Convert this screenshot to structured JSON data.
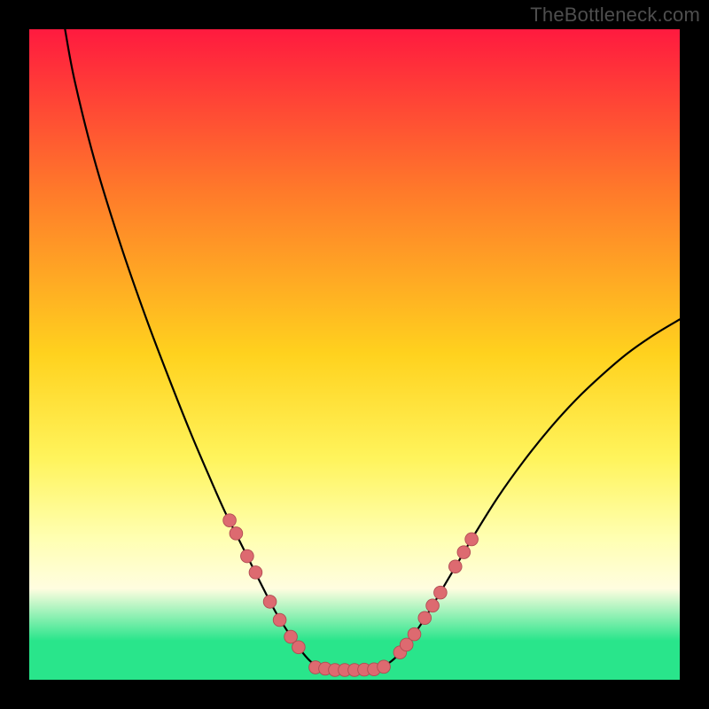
{
  "watermark": {
    "text": "TheBottleneck.com"
  },
  "colors": {
    "bg_black": "#000000",
    "grad_top": "#ff1a3f",
    "grad_mid1": "#ff7a2a",
    "grad_mid2": "#ffd21e",
    "grad_mid3": "#fff45c",
    "grad_low_yellow": "#ffffb0",
    "grad_cream": "#fffde0",
    "grad_green": "#29e58b",
    "curve": "#000000",
    "marker_fill": "#dd6a70",
    "marker_stroke": "#b04b52",
    "watermark": "#707070"
  },
  "chart_data": {
    "type": "line",
    "title": "",
    "xlabel": "",
    "ylabel": "",
    "xlim": [
      0,
      100
    ],
    "ylim": [
      0,
      100
    ],
    "grad_stops": [
      {
        "offset": 0.0,
        "color": "#ff1a3f"
      },
      {
        "offset": 0.25,
        "color": "#ff7a2a"
      },
      {
        "offset": 0.5,
        "color": "#ffd21e"
      },
      {
        "offset": 0.66,
        "color": "#fff45c"
      },
      {
        "offset": 0.78,
        "color": "#ffffb0"
      },
      {
        "offset": 0.86,
        "color": "#fffde0"
      },
      {
        "offset": 0.94,
        "color": "#29e58b"
      },
      {
        "offset": 1.0,
        "color": "#29e58b"
      }
    ],
    "curve_points": [
      {
        "x": 5.5,
        "y": 100.0
      },
      {
        "x": 7.0,
        "y": 92.0
      },
      {
        "x": 10.0,
        "y": 80.0
      },
      {
        "x": 14.0,
        "y": 67.0
      },
      {
        "x": 18.0,
        "y": 55.5
      },
      {
        "x": 22.0,
        "y": 45.0
      },
      {
        "x": 25.0,
        "y": 37.5
      },
      {
        "x": 28.0,
        "y": 30.5
      },
      {
        "x": 30.0,
        "y": 26.0
      },
      {
        "x": 32.0,
        "y": 22.0
      },
      {
        "x": 34.0,
        "y": 18.0
      },
      {
        "x": 36.0,
        "y": 14.0
      },
      {
        "x": 38.0,
        "y": 10.2
      },
      {
        "x": 40.0,
        "y": 7.0
      },
      {
        "x": 42.0,
        "y": 4.2
      },
      {
        "x": 43.5,
        "y": 2.6
      },
      {
        "x": 45.0,
        "y": 1.8
      },
      {
        "x": 47.0,
        "y": 1.5
      },
      {
        "x": 49.0,
        "y": 1.5
      },
      {
        "x": 51.0,
        "y": 1.5
      },
      {
        "x": 53.0,
        "y": 1.6
      },
      {
        "x": 55.0,
        "y": 2.4
      },
      {
        "x": 56.5,
        "y": 3.6
      },
      {
        "x": 58.0,
        "y": 5.4
      },
      {
        "x": 60.0,
        "y": 8.2
      },
      {
        "x": 62.0,
        "y": 11.4
      },
      {
        "x": 64.0,
        "y": 14.8
      },
      {
        "x": 66.0,
        "y": 18.2
      },
      {
        "x": 68.0,
        "y": 21.6
      },
      {
        "x": 72.0,
        "y": 28.0
      },
      {
        "x": 76.0,
        "y": 33.6
      },
      {
        "x": 80.0,
        "y": 38.6
      },
      {
        "x": 84.0,
        "y": 43.0
      },
      {
        "x": 88.0,
        "y": 46.8
      },
      {
        "x": 92.0,
        "y": 50.2
      },
      {
        "x": 96.0,
        "y": 53.0
      },
      {
        "x": 100.0,
        "y": 55.4
      }
    ],
    "marker_r": 1.0,
    "markers_left": [
      {
        "x": 30.8,
        "y": 24.5
      },
      {
        "x": 31.8,
        "y": 22.5
      },
      {
        "x": 33.5,
        "y": 19.0
      },
      {
        "x": 34.8,
        "y": 16.5
      },
      {
        "x": 37.0,
        "y": 12.0
      },
      {
        "x": 38.5,
        "y": 9.2
      },
      {
        "x": 40.2,
        "y": 6.6
      },
      {
        "x": 41.4,
        "y": 5.0
      }
    ],
    "markers_bottom": [
      {
        "x": 44.0,
        "y": 1.9
      },
      {
        "x": 45.5,
        "y": 1.7
      },
      {
        "x": 47.0,
        "y": 1.5
      },
      {
        "x": 48.5,
        "y": 1.5
      },
      {
        "x": 50.0,
        "y": 1.5
      },
      {
        "x": 51.5,
        "y": 1.55
      },
      {
        "x": 53.0,
        "y": 1.6
      },
      {
        "x": 54.5,
        "y": 2.0
      }
    ],
    "markers_right": [
      {
        "x": 57.0,
        "y": 4.2
      },
      {
        "x": 58.0,
        "y": 5.4
      },
      {
        "x": 59.2,
        "y": 7.0
      },
      {
        "x": 60.8,
        "y": 9.5
      },
      {
        "x": 62.0,
        "y": 11.4
      },
      {
        "x": 63.2,
        "y": 13.4
      },
      {
        "x": 65.5,
        "y": 17.4
      },
      {
        "x": 66.8,
        "y": 19.6
      },
      {
        "x": 68.0,
        "y": 21.6
      }
    ]
  }
}
